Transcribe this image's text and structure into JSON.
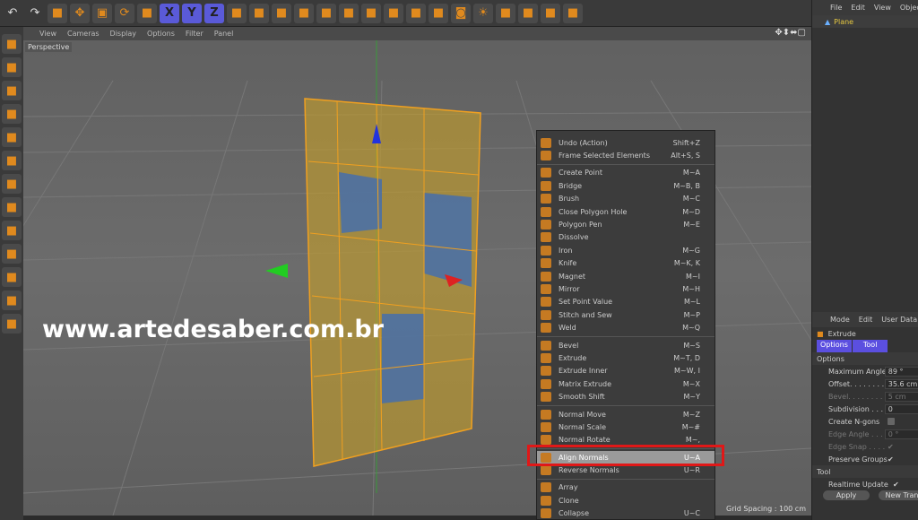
{
  "viewport": {
    "menu": [
      "View",
      "Cameras",
      "Display",
      "Options",
      "Filter",
      "Panel"
    ],
    "camera": "Perspective",
    "grid_spacing": "Grid Spacing : 100 cm",
    "watermark": "www.artedesaber.com.br"
  },
  "toolbar": {
    "icons": [
      "undo-icon",
      "redo-icon",
      "live-selection-icon",
      "move-icon",
      "scale-icon",
      "rotate-icon",
      "model-mode-icon",
      "x-axis-icon",
      "y-axis-icon",
      "z-axis-icon",
      "coordinate-system-icon",
      "render-view-icon",
      "render-picture-viewer-icon",
      "render-settings-icon",
      "cube-icon",
      "pen-icon",
      "subdivision-icon",
      "array-icon",
      "deformer-icon",
      "floor-icon",
      "camera-icon",
      "light-icon",
      "tag-icon",
      "layout-icon",
      "snap-icon",
      "workplane-icon"
    ],
    "axis_labels": [
      "X",
      "Y",
      "Z"
    ]
  },
  "context_menu": {
    "groups": [
      [
        {
          "label": "Undo (Action)",
          "shortcut": "Shift+Z"
        },
        {
          "label": "Frame Selected Elements",
          "shortcut": "Alt+S, S"
        }
      ],
      [
        {
          "label": "Create Point",
          "shortcut": "M~A"
        },
        {
          "label": "Bridge",
          "shortcut": "M~B, B"
        },
        {
          "label": "Brush",
          "shortcut": "M~C"
        },
        {
          "label": "Close Polygon Hole",
          "shortcut": "M~D"
        },
        {
          "label": "Polygon Pen",
          "shortcut": "M~E"
        },
        {
          "label": "Dissolve",
          "shortcut": ""
        },
        {
          "label": "Iron",
          "shortcut": "M~G"
        },
        {
          "label": "Knife",
          "shortcut": "M~K, K"
        },
        {
          "label": "Magnet",
          "shortcut": "M~I"
        },
        {
          "label": "Mirror",
          "shortcut": "M~H"
        },
        {
          "label": "Set Point Value",
          "shortcut": "M~L"
        },
        {
          "label": "Stitch and Sew",
          "shortcut": "M~P"
        },
        {
          "label": "Weld",
          "shortcut": "M~Q"
        }
      ],
      [
        {
          "label": "Bevel",
          "shortcut": "M~S"
        },
        {
          "label": "Extrude",
          "shortcut": "M~T, D"
        },
        {
          "label": "Extrude Inner",
          "shortcut": "M~W, I"
        },
        {
          "label": "Matrix Extrude",
          "shortcut": "M~X"
        },
        {
          "label": "Smooth Shift",
          "shortcut": "M~Y"
        }
      ],
      [
        {
          "label": "Normal Move",
          "shortcut": "M~Z"
        },
        {
          "label": "Normal Scale",
          "shortcut": "M~#"
        },
        {
          "label": "Normal Rotate",
          "shortcut": "M~,"
        }
      ],
      [
        {
          "label": "Align Normals",
          "shortcut": "U~A",
          "highlighted": true
        },
        {
          "label": "Reverse Normals",
          "shortcut": "U~R"
        }
      ],
      [
        {
          "label": "Array",
          "shortcut": ""
        },
        {
          "label": "Clone",
          "shortcut": ""
        },
        {
          "label": "Collapse",
          "shortcut": "U~C"
        }
      ]
    ],
    "highlight_color": "#e01818"
  },
  "object_manager": {
    "menu": [
      "File",
      "Edit",
      "View",
      "Object"
    ],
    "object": "Plane"
  },
  "attribute_manager": {
    "menu": [
      "Mode",
      "Edit",
      "User Data"
    ],
    "tool": "Extrude",
    "tabs": [
      "Options",
      "Tool"
    ],
    "options_header": "Options",
    "fields": [
      {
        "label": "Maximum Angle",
        "value": "89 °"
      },
      {
        "label": "Offset. . . . . . . .",
        "value": "35.6 cm"
      },
      {
        "label": "Bevel. . . . . . . . .",
        "value": "5 cm",
        "disabled": true
      },
      {
        "label": "Subdivision . . . .",
        "value": "0"
      },
      {
        "label": "Create N-gons",
        "value": ""
      },
      {
        "label": "Edge Angle . . . .",
        "value": "0 °",
        "disabled": true
      },
      {
        "label": "Edge Snap . . . . .",
        "value": "✔",
        "disabled": true
      },
      {
        "label": "Preserve Groups",
        "value": "✔"
      }
    ],
    "tool_header": "Tool",
    "realtime_update": {
      "label": "Realtime Update",
      "value": "✔"
    },
    "apply": "Apply",
    "new_transform": "New Tran"
  }
}
